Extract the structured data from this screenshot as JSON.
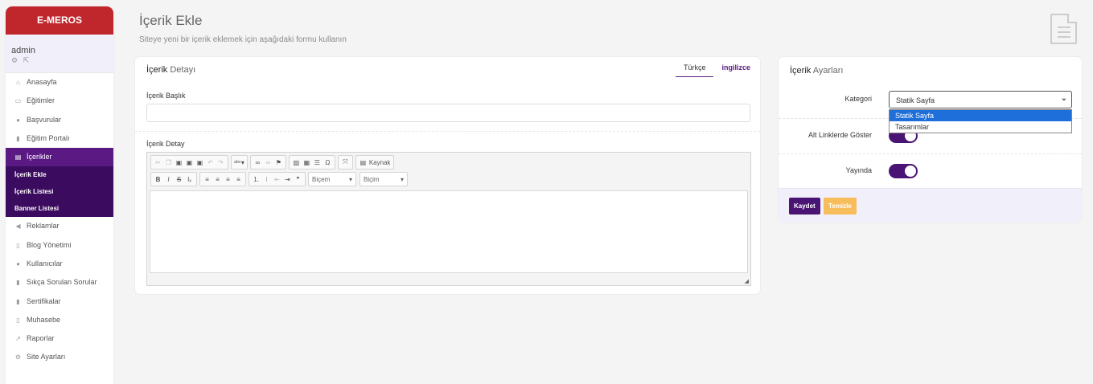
{
  "brand": "E-MEROS",
  "user": {
    "name": "admin",
    "icons": "⚙ ⇱"
  },
  "nav": [
    {
      "label": "Anasayfa",
      "icon": "home-icon"
    },
    {
      "label": "Eğitimler",
      "icon": "book-icon"
    },
    {
      "label": "Başvurular",
      "icon": "users-icon"
    },
    {
      "label": "Eğitim Portalı",
      "icon": "file-icon"
    },
    {
      "label": "İçerikler",
      "icon": "document-icon"
    },
    {
      "label": "İçerik Ekle"
    },
    {
      "label": "İçerik Listesi"
    },
    {
      "label": "Banner Listesi"
    },
    {
      "label": "Reklamlar",
      "icon": "megaphone-icon"
    },
    {
      "label": "Blog Yönetimi",
      "icon": "file-icon"
    },
    {
      "label": "Kullanıcılar",
      "icon": "users-icon"
    },
    {
      "label": "Sıkça Sorulan Sorular",
      "icon": "file-icon"
    },
    {
      "label": "Sertifikalar",
      "icon": "file-icon"
    },
    {
      "label": "Muhasebe",
      "icon": "file-icon"
    },
    {
      "label": "Raporlar",
      "icon": "chart-icon"
    },
    {
      "label": "Site Ayarları",
      "icon": "gear-icon"
    }
  ],
  "page": {
    "title": "İçerik Ekle",
    "subtitle": "Siteye yeni bir içerik eklemek için aşağıdaki formu kullanın"
  },
  "detail": {
    "title_strong": "İçerik",
    "title_rest": " Detayı",
    "tab_tr": "Türkçe",
    "tab_en": "ingilizce",
    "title_label": "İçerik Başlık",
    "detail_label": "İçerik Detay",
    "source_label": "Kaynak",
    "format1": "Biçem",
    "format2": "Biçim"
  },
  "settings": {
    "title_strong": "İçerik",
    "title_rest": " Ayarları",
    "category_label": "Kategori",
    "category_value": "Statik Sayfa",
    "options": [
      "Statik Sayfa",
      "Tasarımlar"
    ],
    "altlinks_label": "Alt Linklerde Göster",
    "published_label": "Yayında",
    "save": "Kaydet",
    "clear": "Temizle"
  },
  "colors": {
    "brand": "#c0272d",
    "accent": "#5b1a83",
    "warning": "#f7bd5b"
  }
}
